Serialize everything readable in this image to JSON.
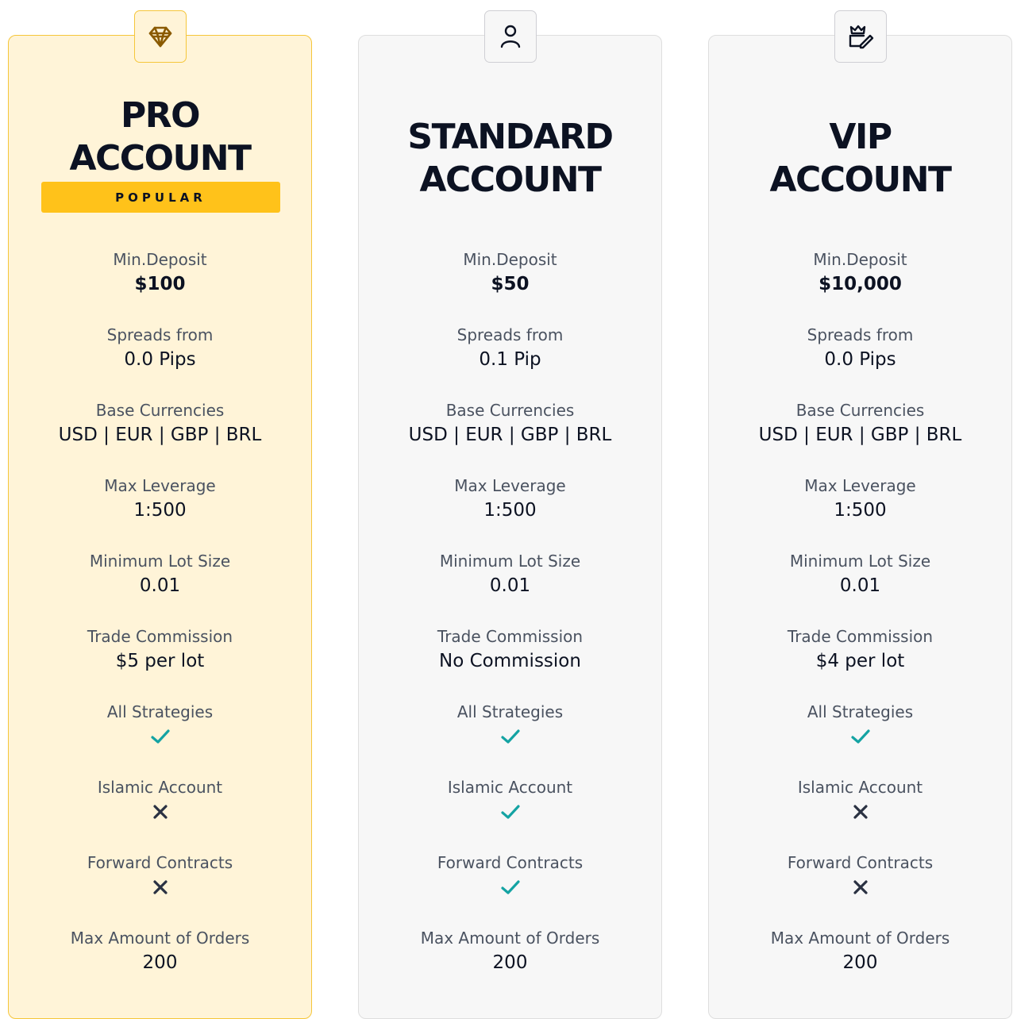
{
  "colors": {
    "check": "#14a3a3",
    "cross": "#2a3142",
    "popular": "#ffc21a",
    "featured_bg": "#fff4d8"
  },
  "cards": [
    {
      "icon": "diamond-icon",
      "title_line1": "PRO",
      "title_line2": "ACCOUNT",
      "badge": "POPULAR",
      "features": [
        {
          "label": "Min.Deposit",
          "value": "$100"
        },
        {
          "label": "Spreads from",
          "value": "0.0 Pips"
        },
        {
          "label": "Base Currencies",
          "value": "USD | EUR | GBP | BRL"
        },
        {
          "label": "Max Leverage",
          "value": "1:500"
        },
        {
          "label": "Minimum Lot Size",
          "value": "0.01"
        },
        {
          "label": "Trade Commission",
          "value": "$5 per lot"
        },
        {
          "label": "All Strategies",
          "value": true
        },
        {
          "label": "Islamic Account",
          "value": false
        },
        {
          "label": "Forward Contracts",
          "value": false
        },
        {
          "label": "Max Amount of Orders",
          "value": "200"
        }
      ]
    },
    {
      "icon": "user-icon",
      "title_line1": "STANDARD",
      "title_line2": "ACCOUNT",
      "features": [
        {
          "label": "Min.Deposit",
          "value": "$50"
        },
        {
          "label": "Spreads from",
          "value": "0.1 Pip"
        },
        {
          "label": "Base Currencies",
          "value": "USD | EUR | GBP | BRL"
        },
        {
          "label": "Max Leverage",
          "value": "1:500"
        },
        {
          "label": "Minimum Lot Size",
          "value": "0.01"
        },
        {
          "label": "Trade Commission",
          "value": "No Commission"
        },
        {
          "label": "All Strategies",
          "value": true
        },
        {
          "label": "Islamic Account",
          "value": true
        },
        {
          "label": "Forward Contracts",
          "value": true
        },
        {
          "label": "Max Amount of Orders",
          "value": "200"
        }
      ]
    },
    {
      "icon": "crown-edit-icon",
      "title_line1": "VIP",
      "title_line2": "ACCOUNT",
      "features": [
        {
          "label": "Min.Deposit",
          "value": "$10,000"
        },
        {
          "label": "Spreads from",
          "value": "0.0 Pips"
        },
        {
          "label": "Base Currencies",
          "value": "USD | EUR | GBP | BRL"
        },
        {
          "label": "Max Leverage",
          "value": "1:500"
        },
        {
          "label": "Minimum Lot Size",
          "value": "0.01"
        },
        {
          "label": "Trade Commission",
          "value": "$4 per lot"
        },
        {
          "label": "All Strategies",
          "value": true
        },
        {
          "label": "Islamic Account",
          "value": false
        },
        {
          "label": "Forward Contracts",
          "value": false
        },
        {
          "label": "Max Amount of Orders",
          "value": "200"
        }
      ]
    }
  ]
}
